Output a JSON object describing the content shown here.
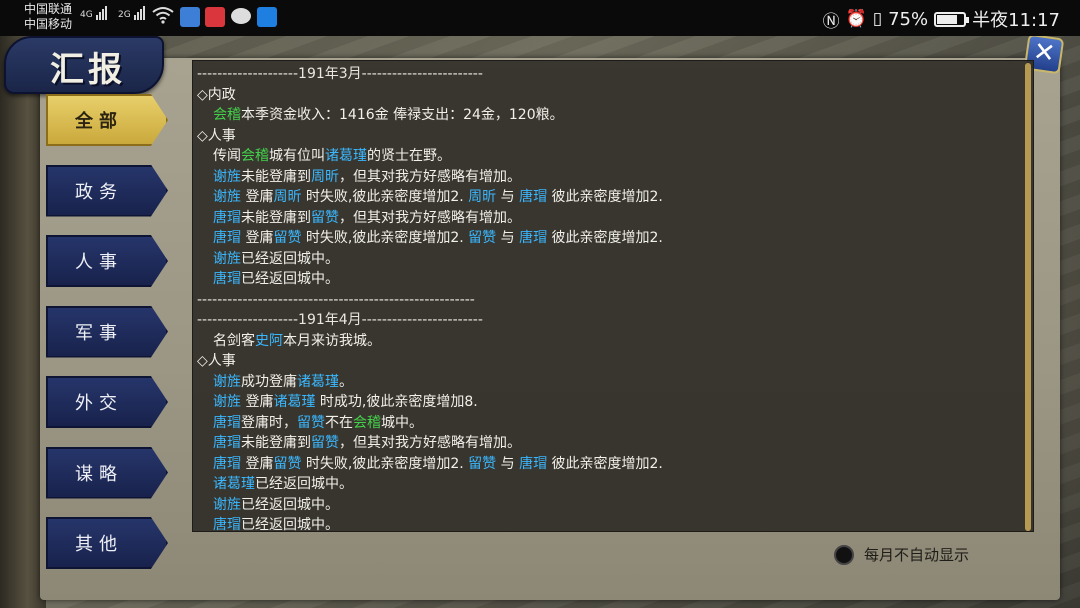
{
  "status_bar": {
    "carrier1": "中国联通",
    "carrier2": "中国移动",
    "net1": "4G",
    "net2": "2G",
    "battery_percent": "75%",
    "battery_level": 0.75,
    "time": "半夜11:17",
    "icons": [
      "nfc-icon",
      "alarm-icon",
      "vibrate-icon",
      "wifi-icon",
      "app-icon-1",
      "app-icon-2",
      "chat-icon",
      "app-icon-3"
    ]
  },
  "window": {
    "title": "汇报",
    "close_icon": "close-icon"
  },
  "tabs": [
    {
      "label": "全部",
      "active": true
    },
    {
      "label": "政务",
      "active": false
    },
    {
      "label": "人事",
      "active": false
    },
    {
      "label": "军事",
      "active": false
    },
    {
      "label": "外交",
      "active": false
    },
    {
      "label": "谋略",
      "active": false
    },
    {
      "label": "其他",
      "active": false
    }
  ],
  "log": [
    {
      "kind": "sep",
      "parts": [
        {
          "t": "--------------------191年3月------------------------"
        }
      ]
    },
    {
      "kind": "head",
      "parts": [
        {
          "t": "◇内政"
        }
      ]
    },
    {
      "kind": "sub",
      "parts": [
        {
          "t": "会稽",
          "c": "green"
        },
        {
          "t": "本季资金收入：1416金 俸禄支出：24金，120粮。"
        }
      ]
    },
    {
      "kind": "head",
      "parts": [
        {
          "t": "◇人事"
        }
      ]
    },
    {
      "kind": "sub",
      "parts": [
        {
          "t": "传闻"
        },
        {
          "t": "会稽",
          "c": "green"
        },
        {
          "t": "城有位叫"
        },
        {
          "t": "诸葛瑾",
          "c": "blue"
        },
        {
          "t": "的贤士在野。"
        }
      ]
    },
    {
      "kind": "sub",
      "parts": [
        {
          "t": "谢旌",
          "c": "blue"
        },
        {
          "t": "未能登庸到"
        },
        {
          "t": "周昕",
          "c": "blue"
        },
        {
          "t": "，但其对我方好感略有增加。"
        }
      ]
    },
    {
      "kind": "sub",
      "parts": [
        {
          "t": "谢旌",
          "c": "blue"
        },
        {
          "t": " 登庸"
        },
        {
          "t": "周昕",
          "c": "blue"
        },
        {
          "t": " 时失败,彼此亲密度增加2. "
        },
        {
          "t": "周昕",
          "c": "blue"
        },
        {
          "t": " 与 "
        },
        {
          "t": "唐瑁",
          "c": "blue"
        },
        {
          "t": " 彼此亲密度增加2."
        }
      ]
    },
    {
      "kind": "sub",
      "parts": [
        {
          "t": "唐瑁",
          "c": "blue"
        },
        {
          "t": "未能登庸到"
        },
        {
          "t": "留赞",
          "c": "blue"
        },
        {
          "t": "，但其对我方好感略有增加。"
        }
      ]
    },
    {
      "kind": "sub",
      "parts": [
        {
          "t": "唐瑁",
          "c": "blue"
        },
        {
          "t": " 登庸"
        },
        {
          "t": "留赞",
          "c": "blue"
        },
        {
          "t": " 时失败,彼此亲密度增加2. "
        },
        {
          "t": "留赞",
          "c": "blue"
        },
        {
          "t": " 与 "
        },
        {
          "t": "唐瑁",
          "c": "blue"
        },
        {
          "t": " 彼此亲密度增加2."
        }
      ]
    },
    {
      "kind": "sub",
      "parts": [
        {
          "t": "谢旌",
          "c": "blue"
        },
        {
          "t": "已经返回城中。"
        }
      ]
    },
    {
      "kind": "sub",
      "parts": [
        {
          "t": "唐瑁",
          "c": "blue"
        },
        {
          "t": "已经返回城中。"
        }
      ]
    },
    {
      "kind": "sep",
      "parts": [
        {
          "t": "-------------------------------------------------------"
        }
      ]
    },
    {
      "kind": "sep",
      "parts": [
        {
          "t": "--------------------191年4月------------------------"
        }
      ]
    },
    {
      "kind": "sub",
      "parts": [
        {
          "t": "名剑客"
        },
        {
          "t": "史阿",
          "c": "blue"
        },
        {
          "t": "本月来访我城。"
        }
      ]
    },
    {
      "kind": "head",
      "parts": [
        {
          "t": "◇人事"
        }
      ]
    },
    {
      "kind": "sub",
      "parts": [
        {
          "t": "谢旌",
          "c": "blue"
        },
        {
          "t": "成功登庸"
        },
        {
          "t": "诸葛瑾",
          "c": "blue"
        },
        {
          "t": "。"
        }
      ]
    },
    {
      "kind": "sub",
      "parts": [
        {
          "t": "谢旌",
          "c": "blue"
        },
        {
          "t": " 登庸"
        },
        {
          "t": "诸葛瑾",
          "c": "blue"
        },
        {
          "t": " 时成功,彼此亲密度增加8."
        }
      ]
    },
    {
      "kind": "sub",
      "parts": [
        {
          "t": "唐瑁",
          "c": "blue"
        },
        {
          "t": "登庸时，"
        },
        {
          "t": "留赞",
          "c": "blue"
        },
        {
          "t": "不在"
        },
        {
          "t": "会稽",
          "c": "green"
        },
        {
          "t": "城中。"
        }
      ]
    },
    {
      "kind": "sub",
      "parts": [
        {
          "t": "唐瑁",
          "c": "blue"
        },
        {
          "t": "未能登庸到"
        },
        {
          "t": "留赞",
          "c": "blue"
        },
        {
          "t": "，但其对我方好感略有增加。"
        }
      ]
    },
    {
      "kind": "sub",
      "parts": [
        {
          "t": "唐瑁",
          "c": "blue"
        },
        {
          "t": " 登庸"
        },
        {
          "t": "留赞",
          "c": "blue"
        },
        {
          "t": " 时失败,彼此亲密度增加2. "
        },
        {
          "t": "留赞",
          "c": "blue"
        },
        {
          "t": " 与 "
        },
        {
          "t": "唐瑁",
          "c": "blue"
        },
        {
          "t": " 彼此亲密度增加2."
        }
      ]
    },
    {
      "kind": "sub",
      "parts": [
        {
          "t": "诸葛瑾",
          "c": "blue"
        },
        {
          "t": "已经返回城中。"
        }
      ]
    },
    {
      "kind": "sub",
      "parts": [
        {
          "t": "谢旌",
          "c": "blue"
        },
        {
          "t": "已经返回城中。"
        }
      ]
    },
    {
      "kind": "sub",
      "parts": [
        {
          "t": "唐瑁",
          "c": "blue"
        },
        {
          "t": "已经返回城中。"
        }
      ]
    }
  ],
  "footer": {
    "auto_show_label": "每月不自动显示",
    "auto_show_checked": false
  },
  "colors": {
    "green": "#43d04a",
    "blue": "#3ab7ff",
    "active_tab": "#e8cf6a",
    "tab": "#26356a"
  }
}
